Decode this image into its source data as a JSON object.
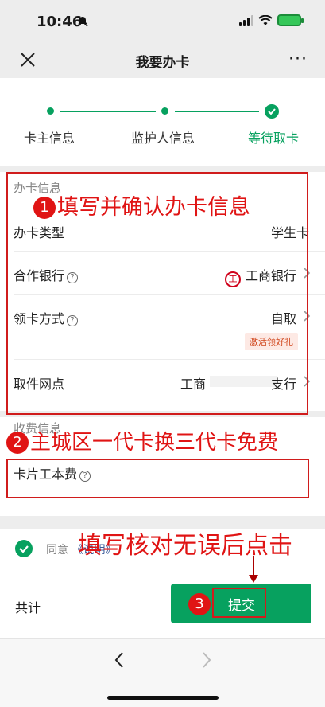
{
  "status_bar": {
    "time": "10:46"
  },
  "navbar": {
    "title": "我要办卡",
    "more": "···"
  },
  "steps": [
    {
      "label": "卡主信息",
      "state": "done"
    },
    {
      "label": "监护人信息",
      "state": "done"
    },
    {
      "label": "等待取卡",
      "state": "active"
    }
  ],
  "card_info": {
    "section_title": "办卡信息",
    "rows": [
      {
        "label": "办卡类型",
        "value": "学生卡"
      },
      {
        "label": "合作银行",
        "value": "工商银行",
        "has_help": true,
        "bank_logo": "工"
      },
      {
        "label": "领卡方式",
        "value": "自取",
        "has_help": true,
        "tag": "激活领好礼"
      },
      {
        "label": "取件网点",
        "value": "工商",
        "value_suffix": "支行"
      }
    ]
  },
  "fee_info": {
    "section_title": "收费信息",
    "row_label": "卡片工本费"
  },
  "agreement": {
    "prefix": "同意",
    "link": "《说明》"
  },
  "bottom": {
    "total_label": "共计",
    "submit_label": "提交"
  },
  "annotations": {
    "a1": {
      "num": "1",
      "text": "填写并确认办卡信息"
    },
    "a2": {
      "num": "2",
      "text": "主城区一代卡换三代卡免费"
    },
    "a3": {
      "text": "填写核对无误后点击"
    },
    "a4": {
      "num": "3"
    }
  },
  "colors": {
    "accent": "#07a15f",
    "annotation": "#e01414"
  }
}
